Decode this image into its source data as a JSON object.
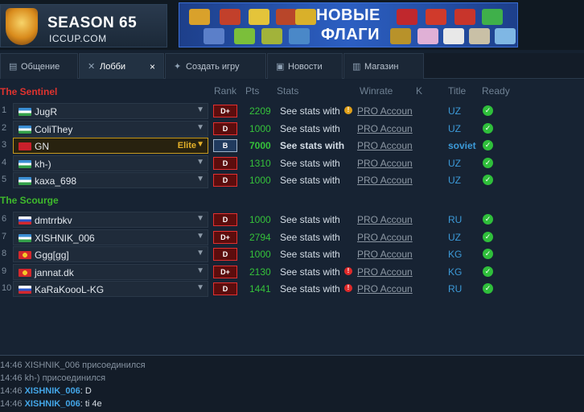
{
  "header": {
    "logo": {
      "season": "SEASON 65",
      "site": "ICCUP.COM"
    },
    "banner": {
      "line1": "НОВЫЕ",
      "line2": "ФЛАГИ"
    }
  },
  "tabs": [
    {
      "label": "Общение",
      "icon": "chat-icon",
      "active": false
    },
    {
      "label": "Лобби",
      "icon": "crossed-swords-icon",
      "active": true,
      "close": "×"
    },
    {
      "label": "Создать игру",
      "icon": "create-game-icon",
      "active": false
    },
    {
      "label": "Новости",
      "icon": "news-icon",
      "active": false
    },
    {
      "label": "Магазин",
      "icon": "cart-icon",
      "active": false
    }
  ],
  "columns": {
    "rank": "Rank",
    "pts": "Pts",
    "stats": "Stats",
    "winrate": "Winrate",
    "k": "K",
    "title": "Title",
    "ready": "Ready"
  },
  "teams": {
    "sentinel": "The Sentinel",
    "scourge": "The Scourge"
  },
  "players": [
    {
      "num": "1",
      "name": "JugR",
      "rank": "D+",
      "pts": "2209",
      "stats": "See stats with",
      "warn": "yellow",
      "winrate": "PRO Accoun",
      "title": "UZ",
      "flag": "uz"
    },
    {
      "num": "2",
      "name": "ColiThey",
      "rank": "D",
      "pts": "1000",
      "stats": "See stats with",
      "winrate": "PRO Accoun",
      "title": "UZ",
      "flag": "uz"
    },
    {
      "num": "3",
      "name": "GN",
      "rank": "B",
      "pts": "7000",
      "stats": "See stats with",
      "winrate": "PRO Accoun",
      "title": "soviet",
      "flag": "ussr",
      "elite": "Elite"
    },
    {
      "num": "4",
      "name": "kh-)",
      "rank": "D",
      "pts": "1310",
      "stats": "See stats with",
      "winrate": "PRO Accoun",
      "title": "UZ",
      "flag": "uz"
    },
    {
      "num": "5",
      "name": "kaxa_698",
      "rank": "D",
      "pts": "1000",
      "stats": "See stats with",
      "winrate": "PRO Accoun",
      "title": "UZ",
      "flag": "uz"
    },
    {
      "num": "6",
      "name": "dmtrrbkv",
      "rank": "D",
      "pts": "1000",
      "stats": "See stats with",
      "winrate": "PRO Accoun",
      "title": "RU",
      "flag": "ru"
    },
    {
      "num": "7",
      "name": "XISHNIK_006",
      "rank": "D+",
      "pts": "2794",
      "stats": "See stats with",
      "winrate": "PRO Accoun",
      "title": "UZ",
      "flag": "uz"
    },
    {
      "num": "8",
      "name": "Ggg[gg]",
      "rank": "D",
      "pts": "1000",
      "stats": "See stats with",
      "winrate": "PRO Accoun",
      "title": "KG",
      "flag": "kg"
    },
    {
      "num": "9",
      "name": "jannat.dk",
      "rank": "D+",
      "pts": "2130",
      "stats": "See stats with",
      "warn": "red",
      "winrate": "PRO Accoun",
      "title": "KG",
      "flag": "kg"
    },
    {
      "num": "10",
      "name": "KaRaKoooL-KG",
      "rank": "D",
      "pts": "1441",
      "stats": "See stats with",
      "warn": "red",
      "winrate": "PRO Accoun",
      "title": "RU",
      "flag": "ru"
    }
  ],
  "chat": [
    {
      "time": "14:46",
      "text": "XISHNIK_006 присоединился"
    },
    {
      "time": "14:46",
      "text": "kh-) присоединился"
    },
    {
      "time": "14:46",
      "user": "XISHNIK_006",
      "text": "D"
    },
    {
      "time": "14:46",
      "user": "XISHNIK_006",
      "text": "ti 4e"
    }
  ],
  "colors": {
    "sentinel": "#e0332f",
    "scourge": "#3fba2c",
    "pts": "#35c23a",
    "title": "#3c9ad8",
    "ready": "#2fbf3b",
    "elite": "#e6b229"
  }
}
